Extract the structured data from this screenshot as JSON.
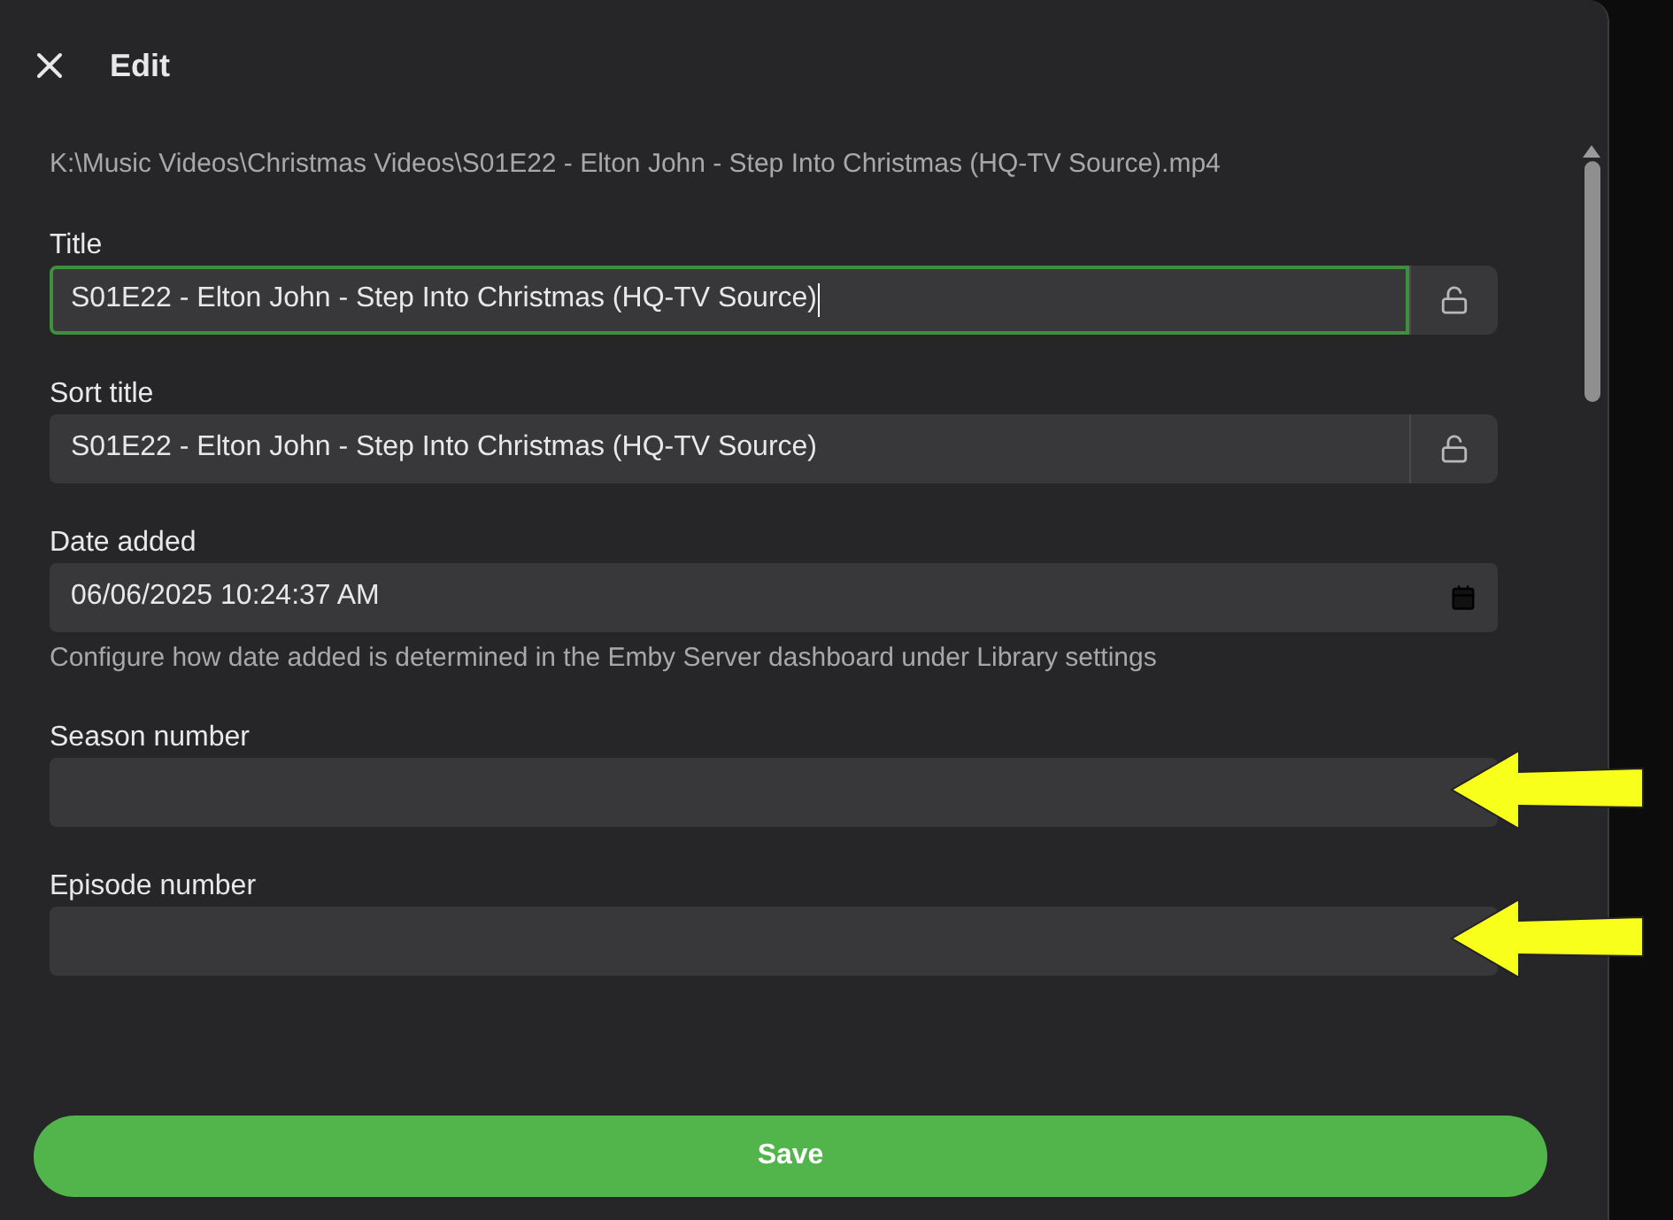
{
  "dialog": {
    "title": "Edit",
    "path": "K:\\Music Videos\\Christmas Videos\\S01E22 - Elton John - Step Into Christmas (HQ-TV Source).mp4"
  },
  "fields": [
    {
      "kind": "text",
      "label": "Title",
      "value": "S01E22 - Elton John - Step Into Christmas (HQ-TV Source)",
      "focused": true,
      "locked": false,
      "annotated": false
    },
    {
      "kind": "text",
      "label": "Sort title",
      "value": "S01E22 - Elton John - Step Into Christmas (HQ-TV Source)",
      "focused": false,
      "locked": false,
      "annotated": false
    },
    {
      "kind": "date",
      "label": "Date added",
      "value": "06/06/2025 10:24:37 AM",
      "help": "Configure how date added is determined in the Emby Server dashboard under Library settings",
      "focused": false,
      "annotated": false
    },
    {
      "kind": "number",
      "label": "Season number",
      "focused": false,
      "annotated": true
    },
    {
      "kind": "number",
      "label": "Episode number",
      "focused": false,
      "annotated": true
    }
  ],
  "save_button": "Save"
}
